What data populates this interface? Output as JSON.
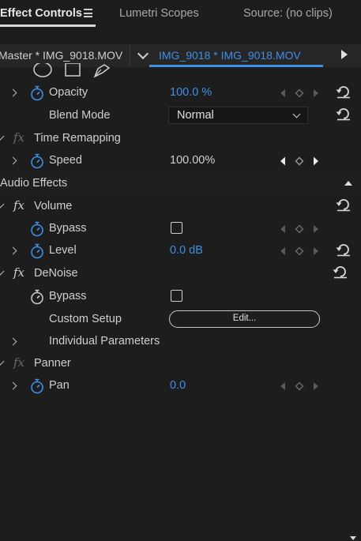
{
  "tabs": {
    "effect_controls": "Effect Controls",
    "lumetri_scopes": "Lumetri Scopes",
    "source": "Source: (no clips)"
  },
  "clip_header": {
    "master": "Master * IMG_9018.MOV",
    "clip": "IMG_9018 * IMG_9018.MOV"
  },
  "rows": {
    "opacity": {
      "label": "Opacity",
      "value": "100.0 %"
    },
    "blend_mode": {
      "label": "Blend Mode",
      "value": "Normal"
    },
    "time_remapping": {
      "label": "Time Remapping"
    },
    "speed": {
      "label": "Speed",
      "value": "100.00%"
    },
    "audio_effects": {
      "label": "Audio Effects"
    },
    "volume": {
      "label": "Volume"
    },
    "volume_bypass": {
      "label": "Bypass"
    },
    "level": {
      "label": "Level",
      "value": "0.0 dB"
    },
    "denoise": {
      "label": "DeNoise"
    },
    "denoise_bypass": {
      "label": "Bypass"
    },
    "custom_setup": {
      "label": "Custom Setup",
      "button": "Edit..."
    },
    "individual_parameters": {
      "label": "Individual Parameters"
    },
    "panner": {
      "label": "Panner"
    },
    "pan": {
      "label": "Pan",
      "value": "0.0"
    }
  },
  "colors": {
    "accent": "#3f8fe6",
    "background": "#1d1d1d",
    "text": "#cfcfcf"
  },
  "icons": [
    "hamburger-menu-icon",
    "chevron-down-icon",
    "play-icon",
    "stopwatch-icon",
    "keyframe-nav-icon",
    "reset-icon",
    "fx-icon",
    "ellipse-mask-icon",
    "rectangle-mask-icon",
    "pen-mask-icon",
    "collapse-up-icon"
  ]
}
